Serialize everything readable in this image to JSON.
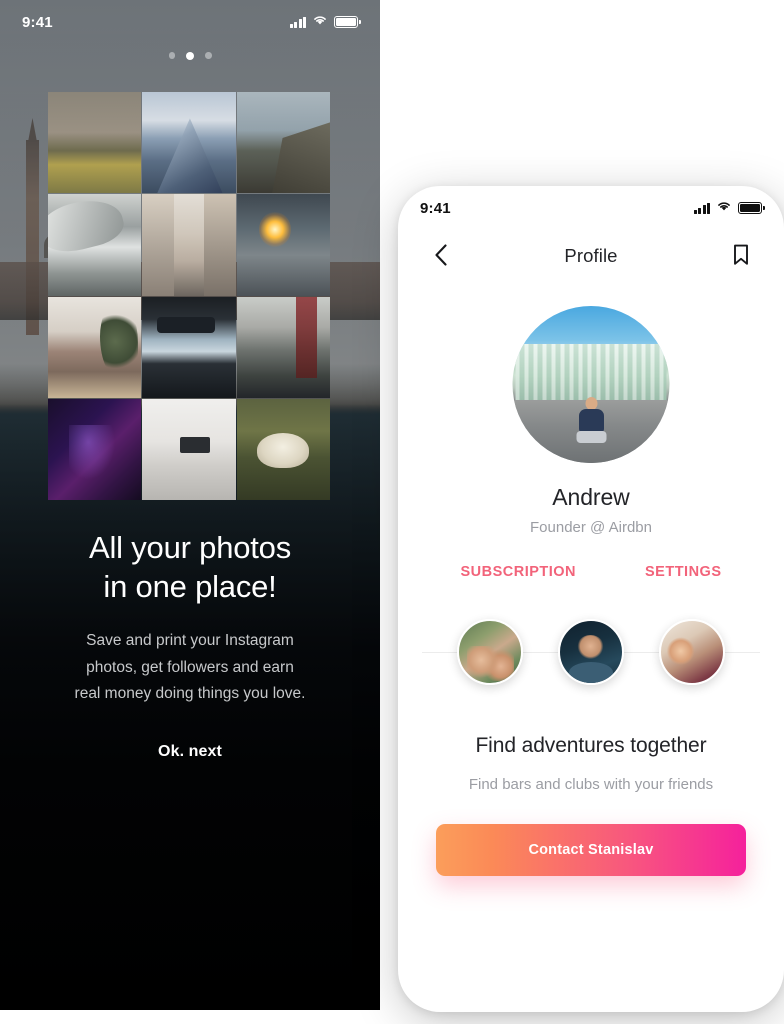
{
  "left_phone": {
    "status_bar": {
      "time": "9:41",
      "signal_icon": "cellular-signal-icon",
      "wifi_icon": "wifi-icon",
      "battery_icon": "battery-icon"
    },
    "page_dots": {
      "total": 3,
      "active_index": 1
    },
    "photo_grid": {
      "columns": 3,
      "rows": 4,
      "photos": [
        {
          "name": "canyon-landscape",
          "class": "p-canyon"
        },
        {
          "name": "snowy-mountain-peak",
          "class": "p-matter"
        },
        {
          "name": "coastal-cliff",
          "class": "p-cliff"
        },
        {
          "name": "ocean-wave",
          "class": "p-wave"
        },
        {
          "name": "man-in-narrow-street",
          "class": "p-street"
        },
        {
          "name": "woman-with-sparkler",
          "class": "p-spark"
        },
        {
          "name": "desert-mountains-camper",
          "class": "p-desert"
        },
        {
          "name": "car-rearview-mirror-road",
          "class": "p-car"
        },
        {
          "name": "venetian-alley-red-curtains",
          "class": "p-venice"
        },
        {
          "name": "guitarist-purple-stage",
          "class": "p-guitar"
        },
        {
          "name": "white-meeting-room",
          "class": "p-room"
        },
        {
          "name": "white-mushroom-in-moss",
          "class": "p-mushroom"
        }
      ]
    },
    "hero": {
      "title_line1": "All your photos",
      "title_line2": "in one place!",
      "body_line1": "Save and print your Instagram",
      "body_line2": "photos, get followers and earn",
      "body_line3": "real money doing things you love.",
      "cta_label": "Ok. next"
    }
  },
  "right_phone": {
    "status_bar": {
      "time": "9:41",
      "signal_icon": "cellular-signal-icon",
      "wifi_icon": "wifi-icon",
      "battery_icon": "battery-icon"
    },
    "navbar": {
      "back_icon": "chevron-left-icon",
      "title": "Profile",
      "bookmark_icon": "bookmark-icon"
    },
    "profile": {
      "avatar_name": "man-sitting-in-front-of-palace",
      "name": "Andrew",
      "role": "Founder @ Airdbn"
    },
    "tabs": [
      {
        "label": "SUBSCRIPTION",
        "name": "tab-subscription"
      },
      {
        "label": "SETTINGS",
        "name": "tab-settings"
      }
    ],
    "friends": [
      {
        "name": "friend-avatar-couple",
        "class": "f-couple"
      },
      {
        "name": "friend-avatar-young-man",
        "class": "f-guy"
      },
      {
        "name": "friend-avatar-woman",
        "class": "f-girl"
      }
    ],
    "promo": {
      "title": "Find adventures together",
      "subtitle": "Find bars and clubs with your friends",
      "cta_label": "Contact Stanislav"
    }
  },
  "colors": {
    "accent_pink": "#F2637A",
    "cta_gradient_start": "#FB9E5B",
    "cta_gradient_end": "#F5219C",
    "text_primary": "#232428",
    "text_muted": "#9B9DA3",
    "dark_bg": "#000000"
  }
}
